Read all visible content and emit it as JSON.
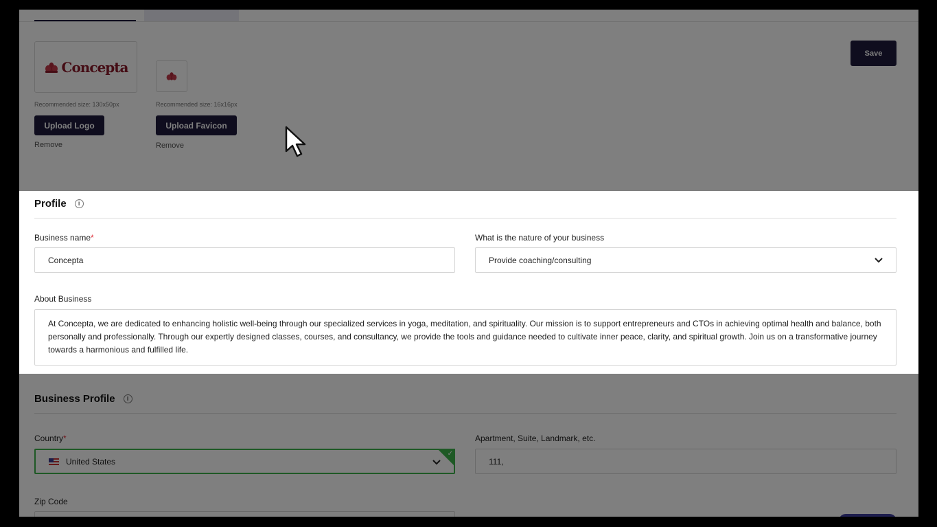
{
  "header": {
    "save_label": "Save"
  },
  "branding": {
    "logo_text": "Concepta",
    "logo_recommended": "Recommended size: 130x50px",
    "favicon_recommended": "Recommended size: 16x16px",
    "upload_logo_label": "Upload Logo",
    "upload_favicon_label": "Upload Favicon",
    "remove_logo_label": "Remove",
    "remove_favicon_label": "Remove"
  },
  "profile": {
    "title": "Profile",
    "business_name_label": "Business name",
    "business_name_value": "Concepta",
    "nature_label": "What is the nature of your business",
    "nature_value": "Provide coaching/consulting",
    "about_label": "About Business",
    "about_value": "At Concepta, we are dedicated to enhancing holistic well-being through our specialized services in yoga, meditation, and spirituality. Our mission is to support entrepreneurs and CTOs in achieving optimal health and balance, both personally and professionally. Through our expertly designed classes, courses, and consultancy, we provide the tools and guidance needed to cultivate inner peace, clarity, and spiritual growth. Join us on a transformative journey towards a harmonious and fulfilled life."
  },
  "business_profile": {
    "title": "Business Profile",
    "country_label": "Country",
    "country_value": "United States",
    "apt_label": "Apartment, Suite, Landmark, etc.",
    "apt_value": "111,",
    "zip_label": "Zip Code"
  },
  "colors": {
    "primary": "#1e1b3c",
    "required": "#e0303a",
    "valid": "#3db34a",
    "logo": "#8a1a2a"
  }
}
